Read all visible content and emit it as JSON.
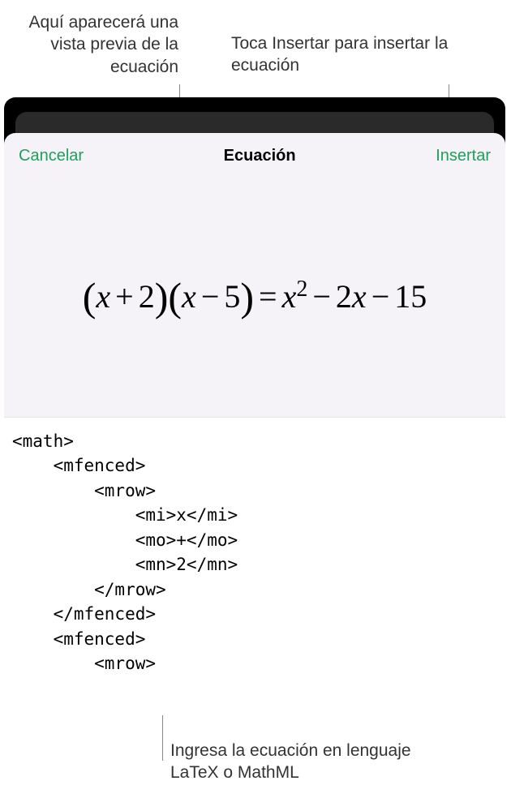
{
  "callouts": {
    "preview": "Aquí aparecerá una vista previa de la ecuación",
    "insert": "Toca Insertar para insertar la ecuación",
    "input": "Ingresa la ecuación en lenguaje LaTeX o MathML"
  },
  "dialog": {
    "cancel_label": "Cancelar",
    "title": "Ecuación",
    "insert_label": "Insertar"
  },
  "equation": {
    "x1": "x",
    "plus": "+",
    "two": "2",
    "x2": "x",
    "minus1": "−",
    "five": "5",
    "equals": "=",
    "x3": "x",
    "exp": "2",
    "minus2": "−",
    "coef2": "2",
    "x4": "x",
    "minus3": "−",
    "fifteen": "15"
  },
  "code": "<math>\n    <mfenced>\n        <mrow>\n            <mi>x</mi>\n            <mo>+</mo>\n            <mn>2</mn>\n        </mrow>\n    </mfenced>\n    <mfenced>\n        <mrow>"
}
